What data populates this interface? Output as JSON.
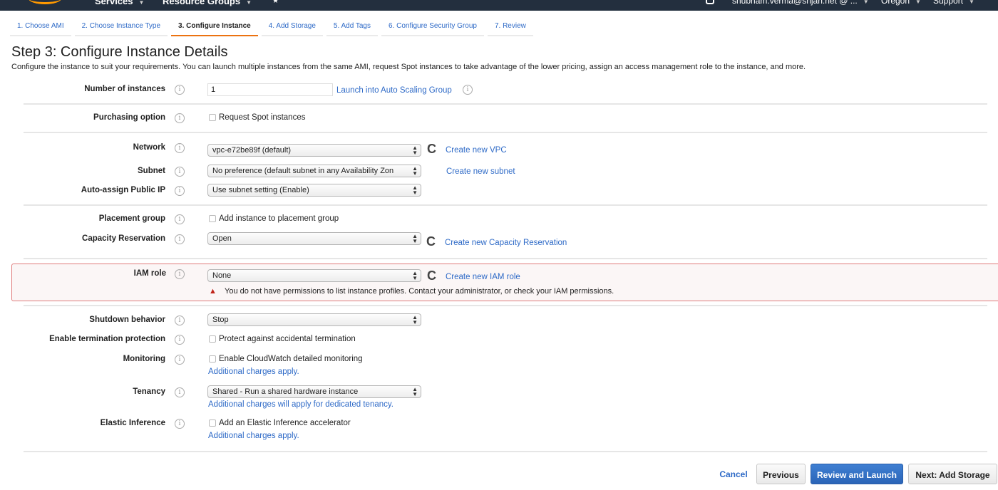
{
  "topnav": {
    "services": "Services",
    "resource_groups": "Resource Groups",
    "account": "shubham.verma@srijan.net @ ...",
    "region": "Oregon",
    "support": "Support",
    "caret": "▼",
    "pin": "★"
  },
  "tabs": [
    {
      "label": "1. Choose AMI",
      "active": false
    },
    {
      "label": "2. Choose Instance Type",
      "active": false
    },
    {
      "label": "3. Configure Instance",
      "active": true
    },
    {
      "label": "4. Add Storage",
      "active": false
    },
    {
      "label": "5. Add Tags",
      "active": false
    },
    {
      "label": "6. Configure Security Group",
      "active": false
    },
    {
      "label": "7. Review",
      "active": false
    }
  ],
  "page": {
    "title": "Step 3: Configure Instance Details",
    "description": "Configure the instance to suit your requirements. You can launch multiple instances from the same AMI, request Spot instances to take advantage of the lower pricing, assign an access management role to the instance, and more."
  },
  "icons": {
    "info": "i",
    "refresh": "C",
    "warning": "▲",
    "select_arrows_up": "▲",
    "select_arrows_down": "▼"
  },
  "form": {
    "number_of_instances": {
      "label": "Number of instances",
      "value": "1",
      "link": "Launch into Auto Scaling Group"
    },
    "purchasing_option": {
      "label": "Purchasing option",
      "checkbox": "Request Spot instances",
      "checked": false
    },
    "network": {
      "label": "Network",
      "value": "vpc-e72be89f (default)",
      "link": "Create new VPC"
    },
    "subnet": {
      "label": "Subnet",
      "value": "No preference (default subnet in any Availability Zon",
      "link": "Create new subnet"
    },
    "auto_assign_ip": {
      "label": "Auto-assign Public IP",
      "value": "Use subnet setting (Enable)"
    },
    "placement_group": {
      "label": "Placement group",
      "checkbox": "Add instance to placement group",
      "checked": false
    },
    "capacity_reservation": {
      "label": "Capacity Reservation",
      "value": "Open",
      "link": "Create new Capacity Reservation"
    },
    "iam_role": {
      "label": "IAM role",
      "value": "None",
      "link": "Create new IAM role",
      "error": "You do not have permissions to list instance profiles. Contact your administrator, or check your IAM permissions."
    },
    "shutdown_behavior": {
      "label": "Shutdown behavior",
      "value": "Stop"
    },
    "termination_protection": {
      "label": "Enable termination protection",
      "checkbox": "Protect against accidental termination",
      "checked": false
    },
    "monitoring": {
      "label": "Monitoring",
      "checkbox": "Enable CloudWatch detailed monitoring",
      "checked": false,
      "note_link": "Additional charges apply."
    },
    "tenancy": {
      "label": "Tenancy",
      "value": "Shared - Run a shared hardware instance",
      "note_link": "Additional charges will apply for dedicated tenancy."
    },
    "elastic_inference": {
      "label": "Elastic Inference",
      "checkbox": "Add an Elastic Inference accelerator",
      "checked": false,
      "note_link": "Additional charges apply."
    }
  },
  "footer": {
    "cancel": "Cancel",
    "previous": "Previous",
    "review_and_launch": "Review and Launch",
    "next": "Next: Add Storage"
  },
  "colors": {
    "nav_bg": "#232f3e",
    "accent_orange": "#ec7211",
    "link_blue": "#2e6ac7",
    "primary_button": "#2b65b8",
    "error_border": "#e07b7b",
    "error_bg": "#fbf6f6",
    "warning_red": "#c0241b"
  }
}
